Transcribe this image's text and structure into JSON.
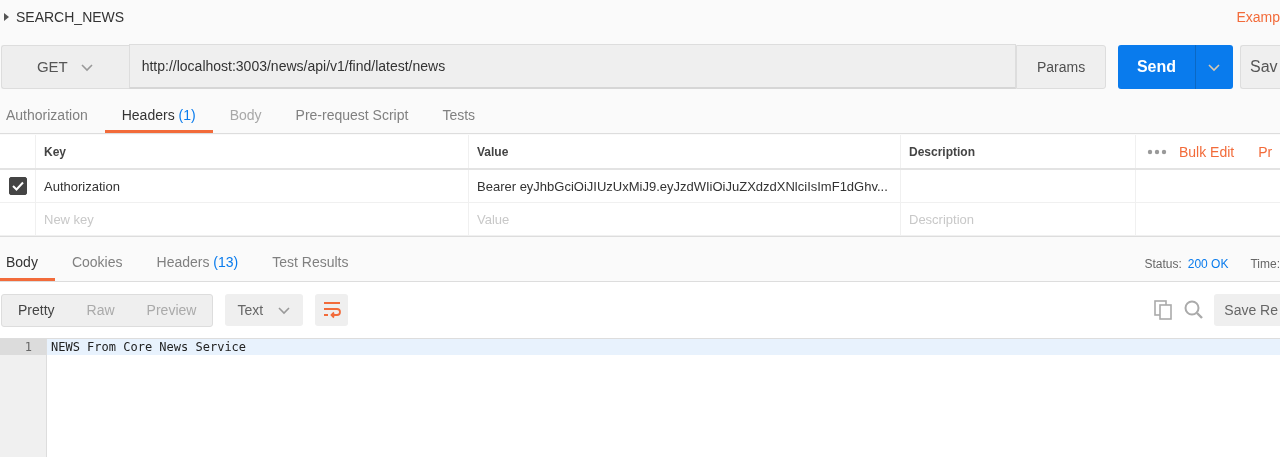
{
  "request": {
    "name": "SEARCH_NEWS",
    "examples_link": "Examp",
    "method": "GET",
    "url": "http://localhost:3003/news/api/v1/find/latest/news",
    "params_button": "Params",
    "send_button": "Send",
    "save_button": "Sav"
  },
  "request_tabs": [
    {
      "label": "Authorization",
      "selected": false,
      "disabled": false
    },
    {
      "label": "Headers",
      "count": "(1)",
      "selected": true,
      "disabled": false
    },
    {
      "label": "Body",
      "selected": false,
      "disabled": true
    },
    {
      "label": "Pre-request Script",
      "selected": false,
      "disabled": false
    },
    {
      "label": "Tests",
      "selected": false,
      "disabled": false
    }
  ],
  "headers_table": {
    "columns": [
      "Key",
      "Value",
      "Description"
    ],
    "bulk_edit": "Bulk Edit",
    "presets": "Pr",
    "rows": [
      {
        "checked": true,
        "key": "Authorization",
        "value": "Bearer eyJhbGciOiJIUzUxMiJ9.eyJzdWIiOiJuZXdzdXNlciIsImF1dGhv..."
      }
    ],
    "new_row": {
      "key_placeholder": "New key",
      "value_placeholder": "Value",
      "description_placeholder": "Description"
    }
  },
  "response": {
    "tabs": [
      {
        "label": "Body",
        "selected": true
      },
      {
        "label": "Cookies",
        "selected": false
      },
      {
        "label": "Headers",
        "count": "(13)",
        "selected": false
      },
      {
        "label": "Test Results",
        "selected": false
      }
    ],
    "status_label": "Status:",
    "status": "200 OK",
    "time_label": "Time:",
    "view_modes": [
      {
        "label": "Pretty",
        "selected": true
      },
      {
        "label": "Raw",
        "selected": false
      },
      {
        "label": "Preview",
        "selected": false
      }
    ],
    "format": "Text",
    "save_button": "Save Re",
    "lines": [
      {
        "number": "1",
        "text": "NEWS From Core News Service"
      }
    ]
  }
}
